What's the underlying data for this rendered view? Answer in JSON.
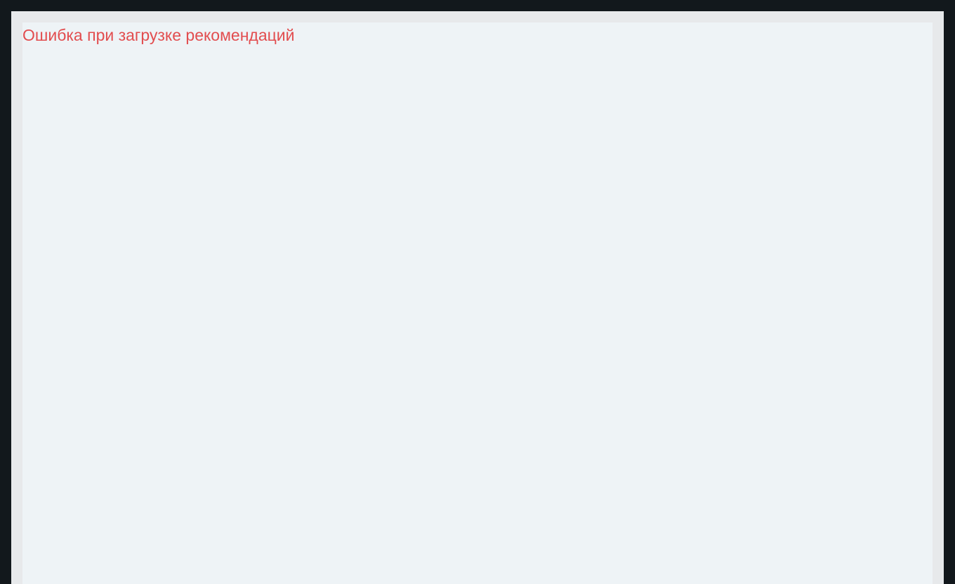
{
  "recommendations": {
    "error_message": "Ошибка при загрузке рекомендаций"
  },
  "colors": {
    "page_background": "#12181c",
    "frame_background": "#e7e9eb",
    "panel_background": "#eef3f6",
    "error_text": "#e24d4f"
  }
}
